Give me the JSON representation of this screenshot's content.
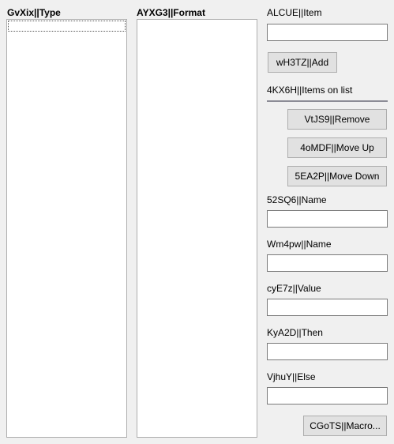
{
  "columns": {
    "type_header": "GvXix||Type",
    "format_header": "AYXG3||Format"
  },
  "item": {
    "label": "ALCUE||Item",
    "value": "",
    "add_button": "wH3TZ||Add"
  },
  "items_on_list": {
    "label": "4KX6H||Items on list",
    "remove_button": "VtJS9||Remove",
    "move_up_button": "4oMDF||Move Up",
    "move_down_button": "5EA2P||Move Down"
  },
  "fields": [
    {
      "label": "52SQ6||Name",
      "value": ""
    },
    {
      "label": "Wm4pw||Name",
      "value": ""
    },
    {
      "label": "cyE7z||Value",
      "value": ""
    },
    {
      "label": "KyA2D||Then",
      "value": ""
    },
    {
      "label": "VjhuY||Else",
      "value": ""
    }
  ],
  "macro_button": "CGoTS||Macro..."
}
